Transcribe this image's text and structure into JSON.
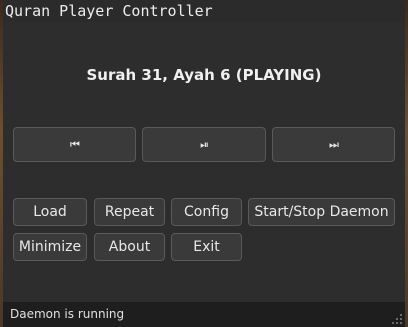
{
  "window": {
    "title": "Quran Player Controller"
  },
  "now_playing": "Surah 31, Ayah 6 (PLAYING)",
  "transport": {
    "prev_icon": "skip-previous-icon",
    "playpause_icon": "play-pause-icon",
    "next_icon": "skip-next-icon",
    "prev_glyph": "⏮",
    "playpause_glyph": "⏯",
    "next_glyph": "⏭"
  },
  "buttons": {
    "load": "Load",
    "repeat": "Repeat",
    "config": "Config",
    "start_stop": "Start/Stop Daemon",
    "minimize": "Minimize",
    "about": "About",
    "exit": "Exit"
  },
  "status": "Daemon is running",
  "colors": {
    "window_bg": "#2d2d2d",
    "button_bg": "#3a3a3a",
    "status_bg": "#1e1e1e"
  }
}
